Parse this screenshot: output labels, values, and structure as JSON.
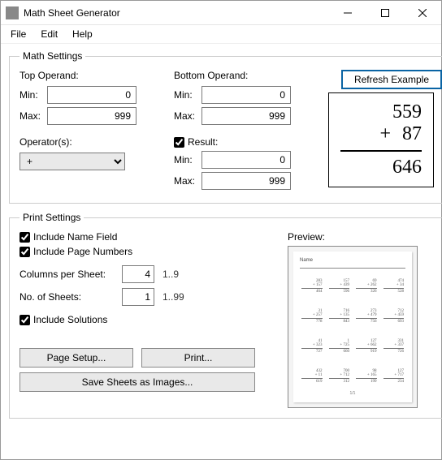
{
  "window": {
    "title": "Math Sheet Generator"
  },
  "menu": {
    "file": "File",
    "edit": "Edit",
    "help": "Help"
  },
  "math": {
    "group_label": "Math Settings",
    "top_operand_label": "Top Operand:",
    "bottom_operand_label": "Bottom Operand:",
    "min_label": "Min:",
    "max_label": "Max:",
    "top_min": "0",
    "top_max": "999",
    "bottom_min": "0",
    "bottom_max": "999",
    "operators_label": "Operator(s):",
    "operator_selected": "+",
    "result_checkbox": "Result:",
    "result_min": "0",
    "result_max": "999",
    "refresh_label": "Refresh Example",
    "example": {
      "top": "559",
      "op": "+",
      "bottom": "87",
      "result": "646"
    }
  },
  "print": {
    "group_label": "Print Settings",
    "include_name": "Include Name Field",
    "include_pagenum": "Include Page Numbers",
    "columns_label": "Columns per Sheet:",
    "columns_value": "4",
    "columns_range": "1..9",
    "sheets_label": "No. of Sheets:",
    "sheets_value": "1",
    "sheets_range": "1..99",
    "include_solutions": "Include Solutions",
    "page_setup": "Page Setup...",
    "print_btn": "Print...",
    "save_images": "Save Sheets as Images...",
    "preview_label": "Preview:",
    "preview_name": "Name",
    "preview_pagenum": "1/1"
  }
}
